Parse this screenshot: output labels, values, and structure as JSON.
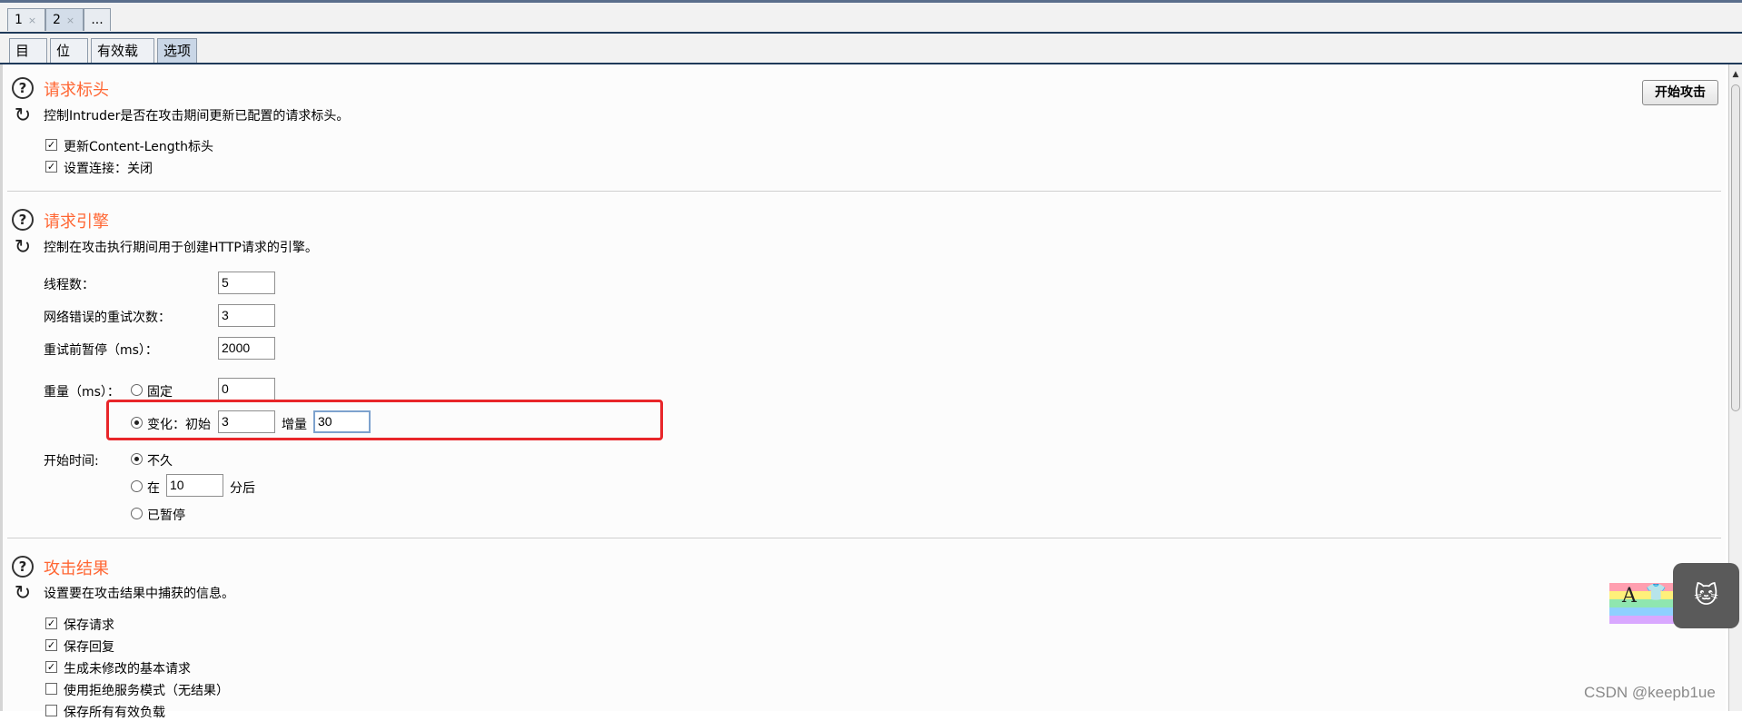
{
  "top_tabs": [
    {
      "label": "1",
      "close": "×"
    },
    {
      "label": "2",
      "close": "×"
    },
    {
      "label": "..."
    }
  ],
  "sub_tabs": [
    "目标",
    "位置",
    "有效载荷",
    "选项"
  ],
  "start_attack_button": "开始攻击",
  "request_headers": {
    "title": "请求标头",
    "description": "控制Intruder是否在攻击期间更新已配置的请求标头。",
    "options": [
      {
        "label": "更新Content-Length标头",
        "checked": true
      },
      {
        "label": "设置连接：关闭",
        "checked": true
      }
    ]
  },
  "request_engine": {
    "title": "请求引擎",
    "description": "控制在攻击执行期间用于创建HTTP请求的引擎。",
    "threads_label": "线程数：",
    "threads_value": "5",
    "retries_label": "网络错误的重试次数：",
    "retries_value": "3",
    "pause_label": "重试前暂停（ms）：",
    "pause_value": "2000",
    "throttle_label": "重量（ms）：",
    "throttle_fixed_label": "固定",
    "throttle_fixed_value": "0",
    "throttle_variable_label": "变化：初始",
    "throttle_variable_initial": "3",
    "throttle_increment_label": "增量",
    "throttle_increment_value": "30",
    "throttle_selected": "variable",
    "start_time_label": "开始时间:",
    "start_immediately": "不久",
    "start_in_label": "在",
    "start_in_value": "10",
    "start_in_suffix": "分后",
    "start_paused": "已暂停",
    "start_selected": "immediately"
  },
  "attack_results": {
    "title": "攻击结果",
    "description": "设置要在攻击结果中捕获的信息。",
    "options": [
      {
        "label": "保存请求",
        "checked": true
      },
      {
        "label": "保存回复",
        "checked": true
      },
      {
        "label": "生成未修改的基本请求",
        "checked": true
      },
      {
        "label": "使用拒绝服务模式（无结果）",
        "checked": false
      },
      {
        "label": "保存所有有效负载",
        "checked": false
      }
    ]
  },
  "watermark": "CSDN @keepb1ue",
  "colors": {
    "section_title": "#ff6633",
    "highlight_box": "#e8262a",
    "tab_underline": "#1f3a5a"
  }
}
